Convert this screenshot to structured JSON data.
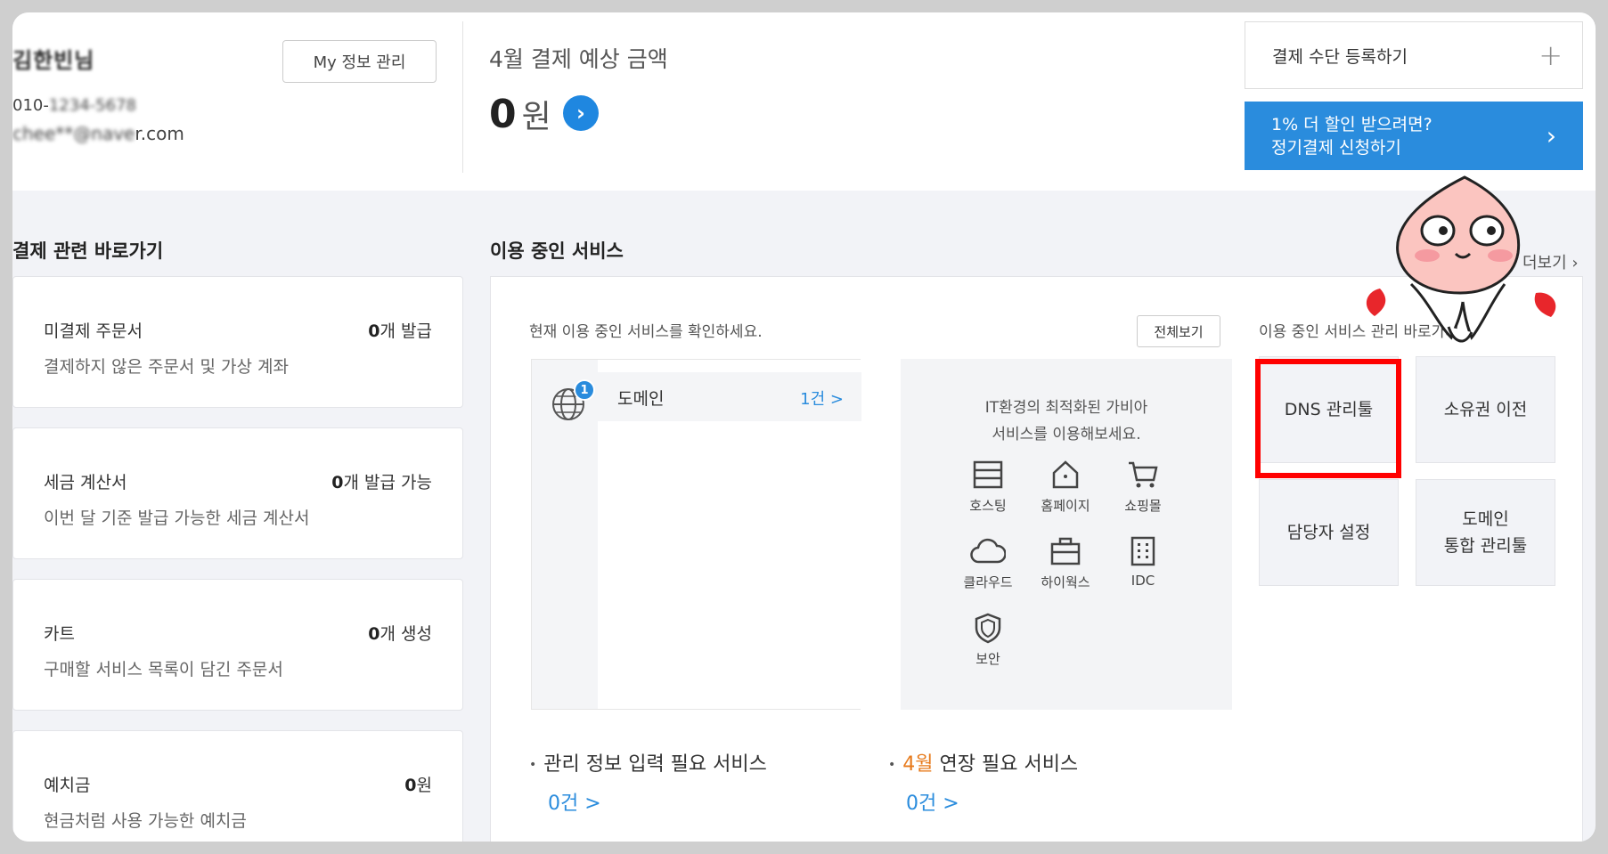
{
  "user": {
    "name": "김한빈님",
    "phone_prefix": "010-",
    "phone_hidden": "1234-5678",
    "email_hidden": "chee**",
    "email_visible": "r.com",
    "email_middle": "@nave",
    "my_info_button": "My 정보 관리"
  },
  "payment": {
    "label": "4월 결제 예상 금액",
    "amount": "0",
    "unit": "원",
    "register_label": "결제 수단 등록하기",
    "promo_line1": "1% 더 할인 받으려면?",
    "promo_line2": "정기결제 신청하기"
  },
  "shortcuts": {
    "title": "결제 관련 바로가기",
    "cards": [
      {
        "title": "미결제 주문서",
        "count": "0",
        "suffix": "개 발급",
        "desc": "결제하지 않은 주문서 및 가상 계좌"
      },
      {
        "title": "세금 계산서",
        "count": "0",
        "suffix": "개 발급 가능",
        "desc": "이번 달 기준 발급 가능한 세금 계산서"
      },
      {
        "title": "카트",
        "count": "0",
        "suffix": "개 생성",
        "desc": "구매할 서비스 목록이 담긴 주문서"
      },
      {
        "title": "예치금",
        "count": "0",
        "suffix": "원",
        "desc": "현금처럼 사용 가능한 예치금"
      }
    ]
  },
  "services": {
    "title": "이용 중인 서비스",
    "more_label": "더보기",
    "desc": "현재 이용 중인 서비스를 확인하세요.",
    "view_all": "전체보기",
    "badge": "1",
    "list": [
      {
        "name": "도메인",
        "count": "1건 >"
      }
    ],
    "it_text_line1": "IT환경의 최적화된 가비아",
    "it_text_line2": "서비스를 이용해보세요.",
    "it_items": [
      {
        "label": "호스팅",
        "icon": "hosting-icon"
      },
      {
        "label": "홈페이지",
        "icon": "homepage-icon"
      },
      {
        "label": "쇼핑몰",
        "icon": "cart-icon"
      },
      {
        "label": "클라우드",
        "icon": "cloud-icon"
      },
      {
        "label": "하이웍스",
        "icon": "briefcase-icon"
      },
      {
        "label": "IDC",
        "icon": "building-icon"
      },
      {
        "label": "보안",
        "icon": "shield-icon"
      }
    ],
    "tools_desc": "이용 중인 서비스 관리 바로가기.",
    "tools": [
      {
        "label": "DNS 관리툴"
      },
      {
        "label": "소유권 이전"
      },
      {
        "label": "담당자 설정"
      },
      {
        "label_line1": "도메인",
        "label_line2": "통합 관리툴"
      }
    ],
    "bullets": [
      {
        "text": "관리 정보 입력 필요 서비스",
        "count": "0건 >"
      },
      {
        "highlight": "4월",
        "text": " 연장 필요 서비스",
        "count": "0건 >"
      }
    ]
  },
  "colors": {
    "accent": "#2a8cdd",
    "highlight_box": "#ff0000",
    "orange": "#e77b1d"
  }
}
